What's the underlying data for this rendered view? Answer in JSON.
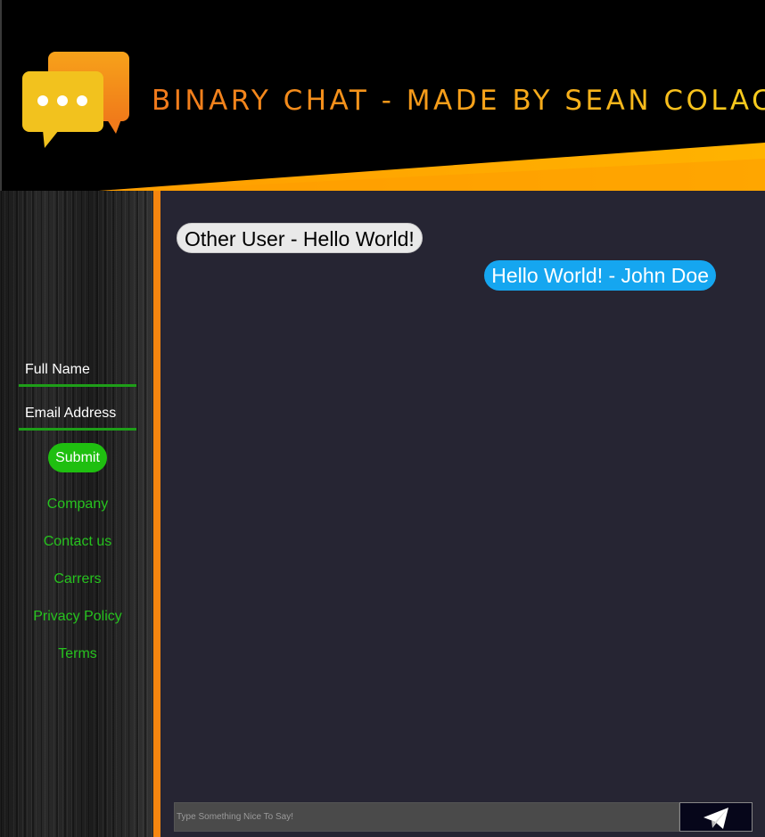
{
  "header": {
    "title": "BINARY CHAT - MADE BY SEAN COLACO",
    "logo_icon": "chat-bubbles-icon"
  },
  "sidebar": {
    "name_placeholder": "Full Name",
    "email_placeholder": "Email Address",
    "submit_label": "Submit",
    "links": [
      "Company",
      "Contact us",
      "Carrers",
      "Privacy Policy",
      "Terms"
    ]
  },
  "chat": {
    "messages": [
      {
        "text": "Other User - Hello World!",
        "side": "left"
      },
      {
        "text": "Hello World! - John Doe",
        "side": "right"
      }
    ],
    "input_placeholder": "Type Something Nice To Say!",
    "send_icon": "paper-plane-icon"
  },
  "colors": {
    "accent_orange": "#f7860f",
    "accent_green": "#1fbf10",
    "chat_background": "#262533",
    "my_bubble": "#15a6f0",
    "other_bubble": "#e9e9e9"
  }
}
